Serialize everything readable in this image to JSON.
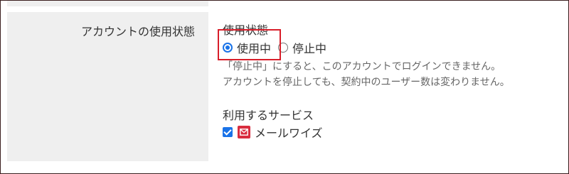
{
  "field": {
    "label": "アカウントの使用状態"
  },
  "usage_status": {
    "title": "使用状態",
    "options": [
      {
        "label": "使用中",
        "checked": true
      },
      {
        "label": "停止中",
        "checked": false
      }
    ],
    "note_lines": [
      "「停止中」にすると、このアカウントでログインできません。",
      "アカウントを停止しても、契約中のユーザー数は変わりません。"
    ]
  },
  "services": {
    "title": "利用するサービス",
    "items": [
      {
        "name": "メールワイズ",
        "checked": true,
        "icon": "mail-icon"
      }
    ]
  },
  "colors": {
    "accent": "#1a73e8",
    "highlight": "#d81e2a",
    "service_icon_bg": "#d92d3f"
  }
}
